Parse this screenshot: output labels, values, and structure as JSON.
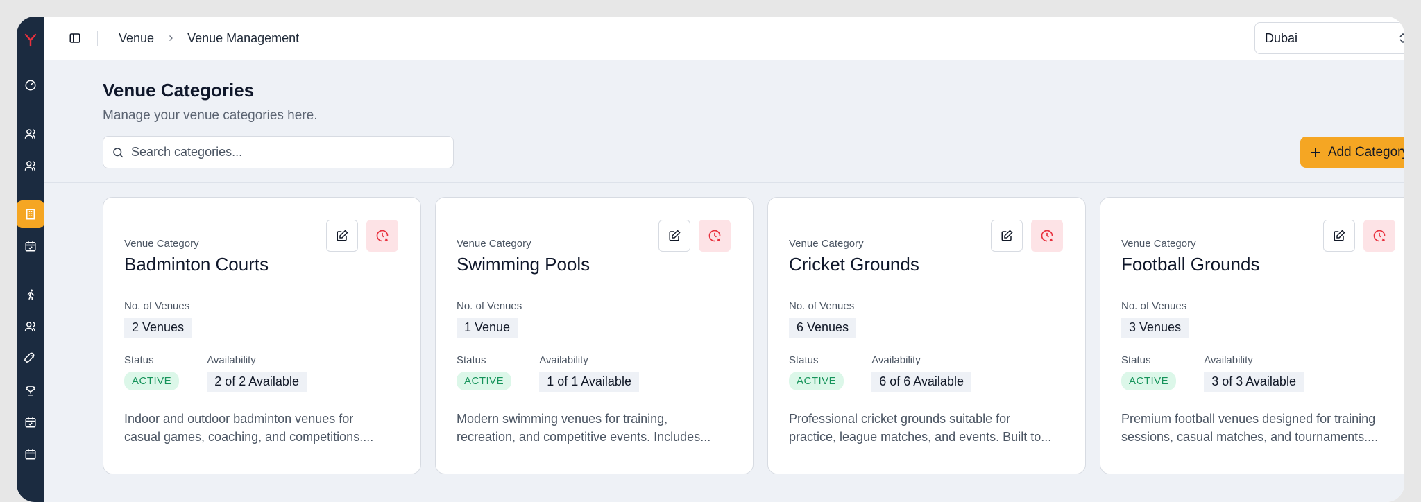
{
  "breadcrumb": {
    "item1": "Venue",
    "item2": "Venue Management"
  },
  "location_select": {
    "value": "Dubai"
  },
  "page": {
    "title": "Venue Categories",
    "subtitle": "Manage your venue categories here."
  },
  "search": {
    "placeholder": "Search categories..."
  },
  "add_button": {
    "label": "Add Category"
  },
  "labels": {
    "venue_category": "Venue Category",
    "no_of_venues": "No. of Venues",
    "status": "Status",
    "availability": "Availability"
  },
  "cards": [
    {
      "title": "Badminton Courts",
      "venues": "2 Venues",
      "status": "ACTIVE",
      "availability": "2 of 2 Available",
      "desc1": "Indoor and outdoor badminton venues for",
      "desc2": "casual games, coaching, and competitions...."
    },
    {
      "title": "Swimming Pools",
      "venues": "1 Venue",
      "status": "ACTIVE",
      "availability": "1 of 1 Available",
      "desc1": "Modern swimming venues for training,",
      "desc2": "recreation, and competitive events. Includes..."
    },
    {
      "title": "Cricket Grounds",
      "venues": "6 Venues",
      "status": "ACTIVE",
      "availability": "6 of 6 Available",
      "desc1": "Professional cricket grounds suitable for",
      "desc2": "practice, league matches, and events. Built to..."
    },
    {
      "title": "Football Grounds",
      "venues": "3 Venues",
      "status": "ACTIVE",
      "availability": "3 of 3 Available",
      "desc1": "Premium football venues designed for training",
      "desc2": "sessions, casual matches, and tournaments...."
    }
  ],
  "colors": {
    "sidebar": "#1b2b40",
    "accent": "#f5a623",
    "active_badge_bg": "#dcf7e9",
    "active_badge_text": "#15935a",
    "danger_bg": "#fde3e6"
  },
  "icons": {
    "sidebar": [
      "logo-icon",
      "dashboard-icon",
      "users-icon",
      "team-icon",
      "building-icon",
      "calendar-check-icon",
      "runner-icon",
      "group-icon",
      "rocket-icon",
      "trophy-icon",
      "calendar-icon",
      "calendar-alt-icon"
    ]
  }
}
